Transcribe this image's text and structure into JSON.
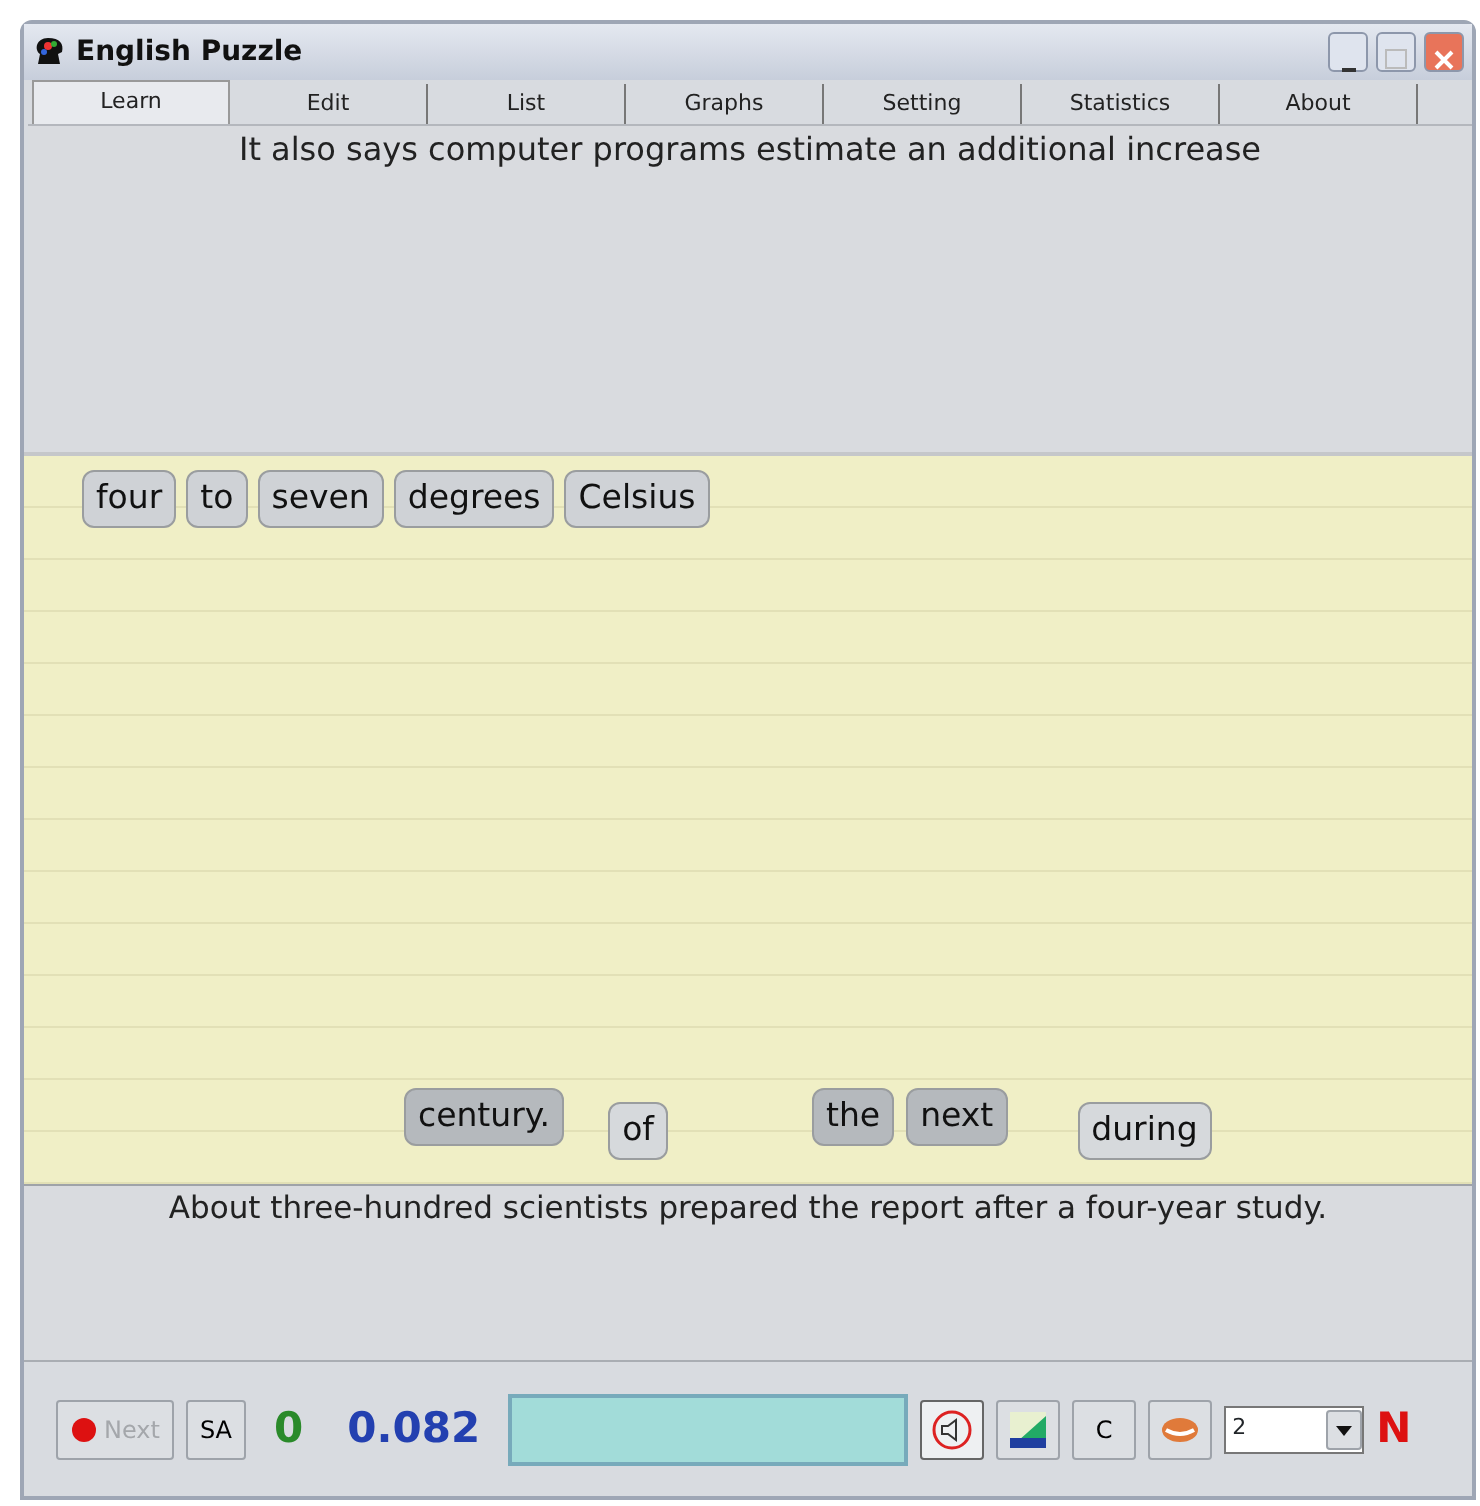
{
  "window": {
    "title": "English Puzzle"
  },
  "tabs": [
    {
      "label": "Learn",
      "selected": true
    },
    {
      "label": "Edit",
      "selected": false
    },
    {
      "label": "List",
      "selected": false
    },
    {
      "label": "Graphs",
      "selected": false
    },
    {
      "label": "Setting",
      "selected": false
    },
    {
      "label": "Statistics",
      "selected": false
    },
    {
      "label": "About",
      "selected": false
    }
  ],
  "prompt": "It also says computer programs estimate an additional increase",
  "placed_words": [
    {
      "text": "four"
    },
    {
      "text": "to"
    },
    {
      "text": "seven"
    },
    {
      "text": "degrees"
    },
    {
      "text": "Celsius"
    }
  ],
  "loose_words": [
    {
      "text": "century.",
      "kind": "dark"
    },
    {
      "text": "of",
      "kind": "light"
    },
    {
      "text": "the",
      "kind": "dark"
    },
    {
      "text": "next",
      "kind": "dark"
    },
    {
      "text": "during",
      "kind": "light"
    }
  ],
  "next_sentence": "About three-hundred scientists prepared the report after a four-year study.",
  "toolbar": {
    "next_button": {
      "label": "Next",
      "disabled": true
    },
    "sa_button": "SA",
    "score": "0",
    "time": "0.082",
    "c_button": "C",
    "speaker_pressed": true,
    "level_select": "2",
    "mode": "N"
  }
}
